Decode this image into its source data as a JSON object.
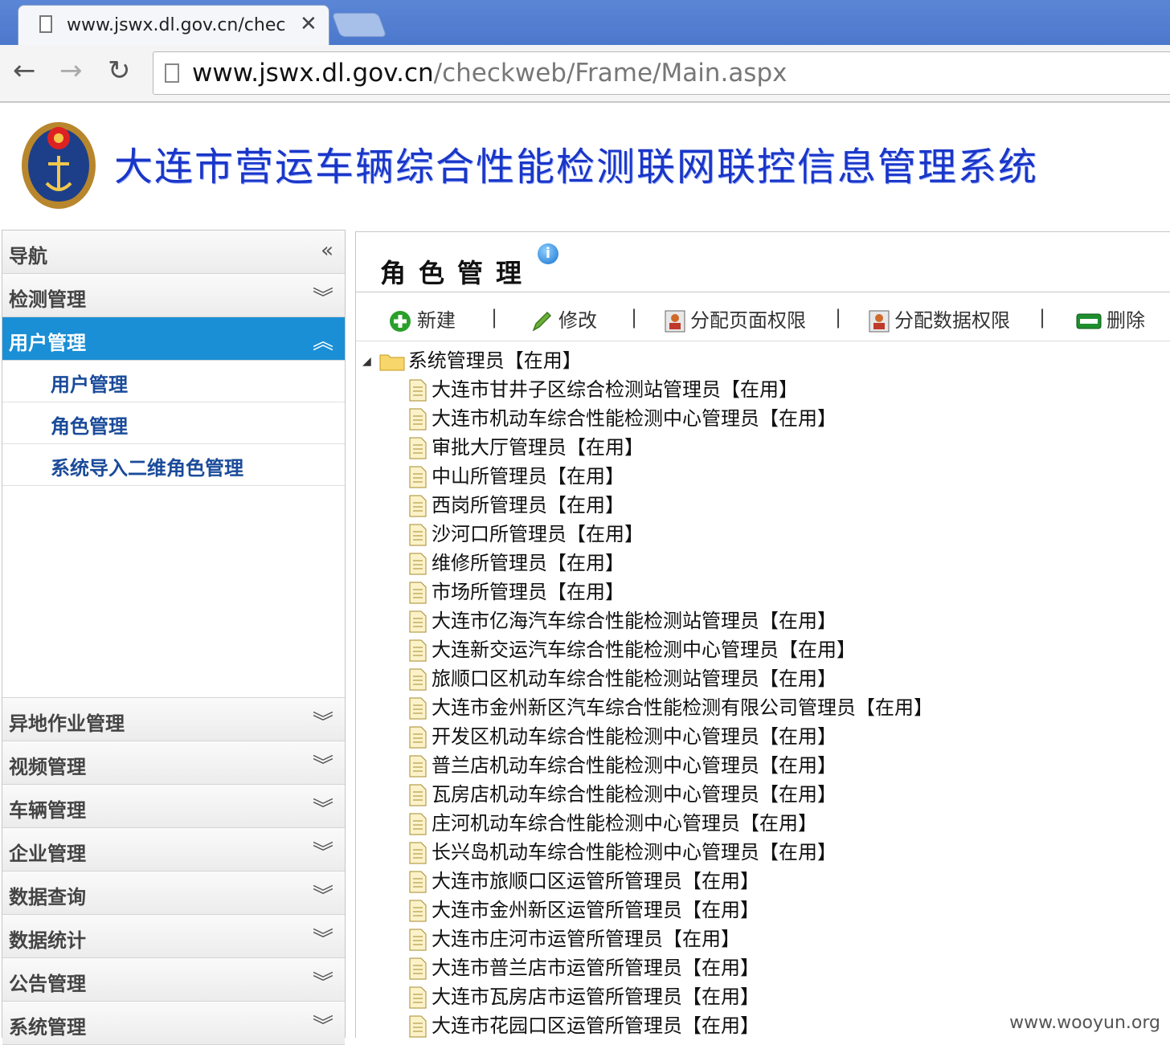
{
  "browser": {
    "tab_title": "www.jswx.dl.gov.cn/chec",
    "tab_close": "✕",
    "url_host": "www.jswx.dl.gov.cn",
    "url_path": "/checkweb/Frame/Main.aspx",
    "back": "←",
    "forward": "→",
    "reload": "↻"
  },
  "banner": {
    "title": "大连市营运车辆综合性能检测联网联控信息管理系统"
  },
  "sidebar": {
    "nav_title": "导航",
    "nav_collapse": "«",
    "groups": [
      {
        "label": "检测管理",
        "chev": "︾"
      },
      {
        "label": "用户管理",
        "chev": "︽"
      },
      {
        "label": "异地作业管理",
        "chev": "︾"
      },
      {
        "label": "视频管理",
        "chev": "︾"
      },
      {
        "label": "车辆管理",
        "chev": "︾"
      },
      {
        "label": "企业管理",
        "chev": "︾"
      },
      {
        "label": "数据查询",
        "chev": "︾"
      },
      {
        "label": "数据统计",
        "chev": "︾"
      },
      {
        "label": "公告管理",
        "chev": "︾"
      },
      {
        "label": "系统管理",
        "chev": "︾"
      }
    ],
    "subitems": [
      "用户管理",
      "角色管理",
      "系统导入二维角色管理"
    ]
  },
  "main": {
    "title": "角色管理",
    "info": "i",
    "actions": {
      "new": "新建",
      "edit": "修改",
      "page_perm": "分配页面权限",
      "data_perm": "分配数据权限",
      "delete": "删除",
      "sep": "|"
    },
    "tree_root": "系统管理员【在用】",
    "tree_expander": "◢",
    "tree_children": [
      "大连市甘井子区综合检测站管理员【在用】",
      "大连市机动车综合性能检测中心管理员【在用】",
      "审批大厅管理员【在用】",
      "中山所管理员【在用】",
      "西岗所管理员【在用】",
      "沙河口所管理员【在用】",
      "维修所管理员【在用】",
      "市场所管理员【在用】",
      "大连市亿海汽车综合性能检测站管理员【在用】",
      "大连新交运汽车综合性能检测中心管理员【在用】",
      "旅顺口区机动车综合性能检测站管理员【在用】",
      "大连市金州新区汽车综合性能检测有限公司管理员【在用】",
      "开发区机动车综合性能检测中心管理员【在用】",
      "普兰店机动车综合性能检测中心管理员【在用】",
      "瓦房店机动车综合性能检测中心管理员【在用】",
      "庄河机动车综合性能检测中心管理员【在用】",
      "长兴岛机动车综合性能检测中心管理员【在用】",
      "大连市旅顺口区运管所管理员【在用】",
      "大连市金州新区运管所管理员【在用】",
      "大连市庄河市运管所管理员【在用】",
      "大连市普兰店市运管所管理员【在用】",
      "大连市瓦房店市运管所管理员【在用】",
      "大连市花园口区运管所管理员【在用】"
    ]
  },
  "watermark": "www.wooyun.org",
  "colors": {
    "accent": "#1a8fd5",
    "banner_text": "#1a36c8",
    "tabstrip": "#5b86d6"
  }
}
